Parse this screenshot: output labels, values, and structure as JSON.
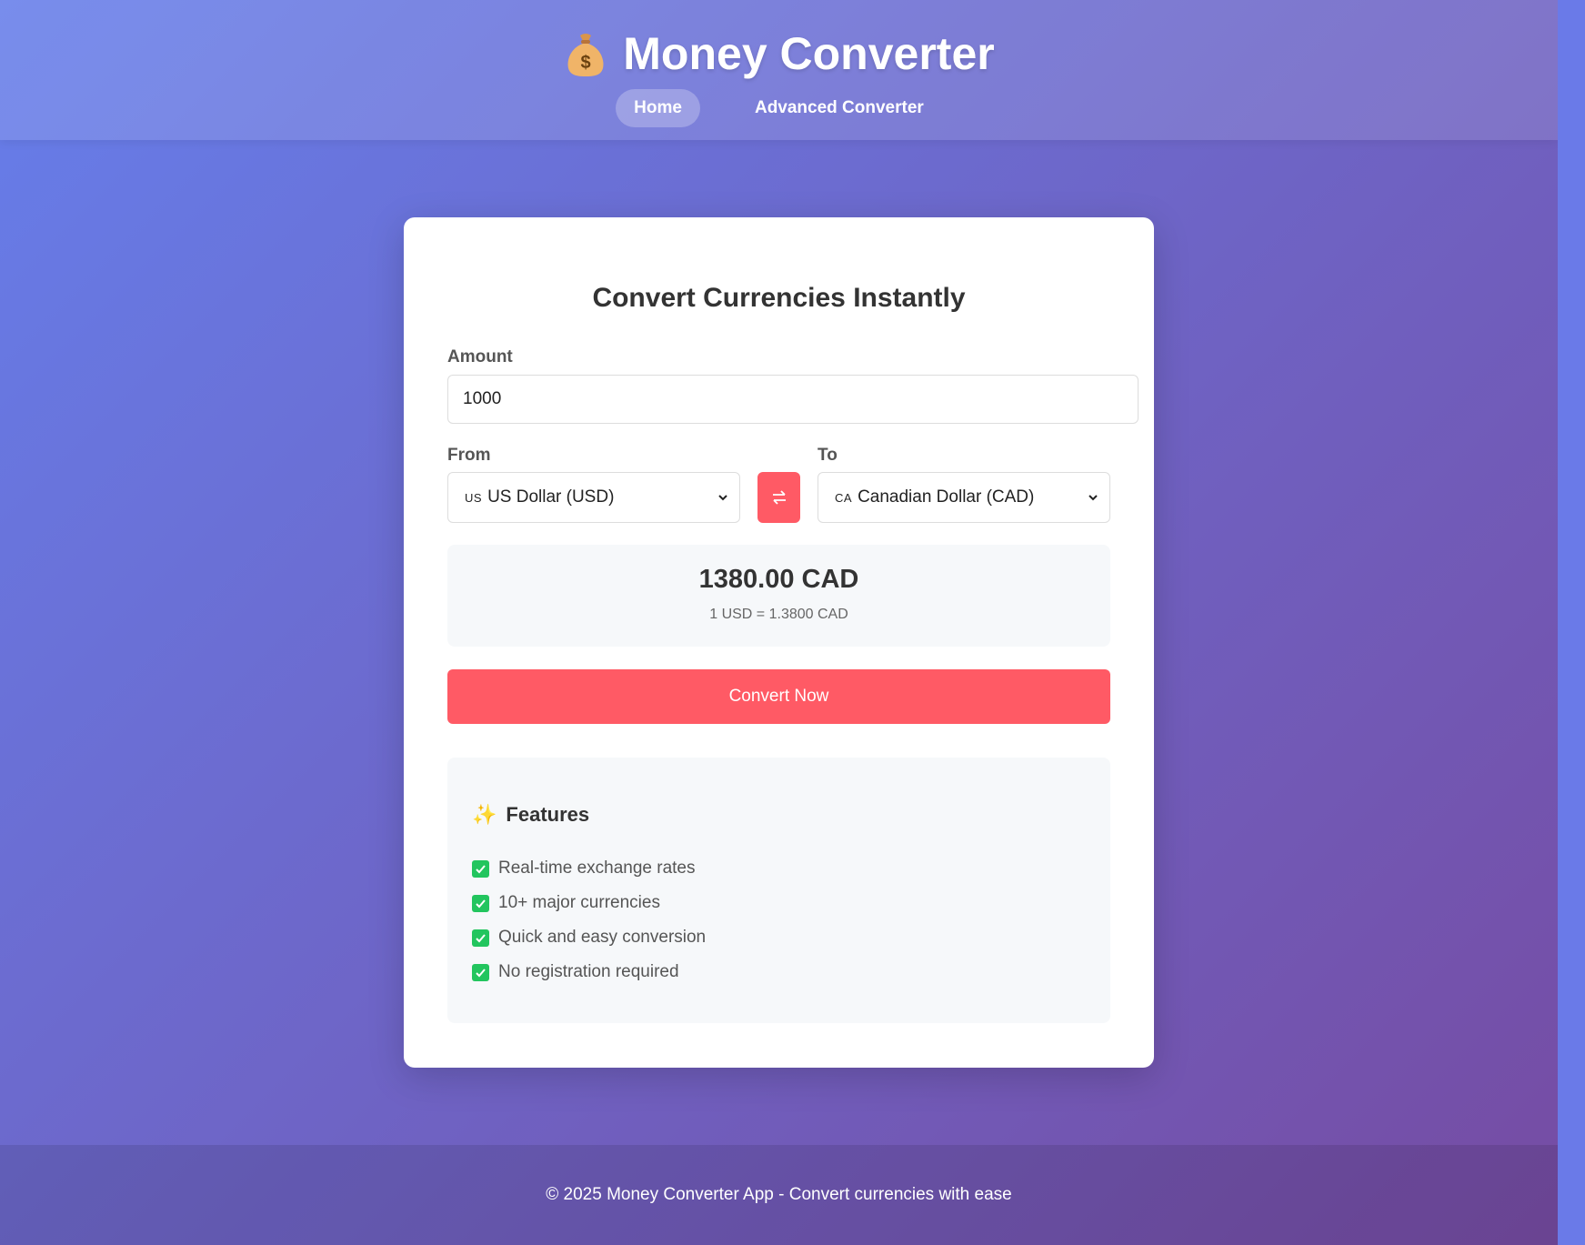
{
  "app": {
    "title": "Money Converter",
    "logo_icon": "money-bag-icon"
  },
  "nav": {
    "items": [
      {
        "label": "Home",
        "active": true
      },
      {
        "label": "Advanced Converter",
        "active": false
      }
    ]
  },
  "converter": {
    "heading": "Convert Currencies Instantly",
    "amount_label": "Amount",
    "amount_value": "1000",
    "from_label": "From",
    "from_flag": "US",
    "from_value": "US Dollar (USD)",
    "to_label": "To",
    "to_flag": "CA",
    "to_value": "Canadian Dollar (CAD)",
    "swap_icon": "swap-arrows-icon",
    "result_amount": "1380.00 CAD",
    "result_rate": "1 USD = 1.3800 CAD",
    "convert_label": "Convert Now"
  },
  "features": {
    "title": "Features",
    "icon": "sparkles-icon",
    "items": [
      "Real-time exchange rates",
      "10+ major currencies",
      "Quick and easy conversion",
      "No registration required"
    ]
  },
  "footer": {
    "text": "© 2025 Money Converter App - Convert currencies with ease"
  },
  "colors": {
    "gradient_start": "#667eea",
    "gradient_end": "#764ba2",
    "accent": "#ff5a65",
    "check": "#22c55e"
  }
}
